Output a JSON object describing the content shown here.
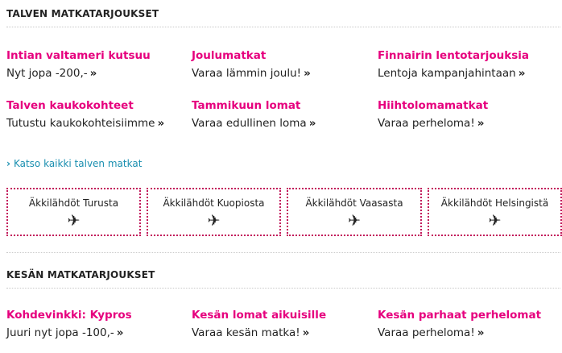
{
  "winter": {
    "title": "TALVEN MATKATARJOUKSET",
    "offers": [
      {
        "title": "Intian valtameri kutsuu",
        "subtitle": "Nyt jopa -200,-"
      },
      {
        "title": "Joulumatkat",
        "subtitle": "Varaa lämmin joulu!"
      },
      {
        "title": "Finnairin lentotarjouksia",
        "subtitle": "Lentoja kampanjahintaan"
      },
      {
        "title": "Talven kaukokohteet",
        "subtitle": "Tutustu kaukokohteisiimme"
      },
      {
        "title": "Tammikuun lomat",
        "subtitle": "Varaa edullinen loma"
      },
      {
        "title": "Hiihtolomamatkat",
        "subtitle": "Varaa perheloma!"
      }
    ],
    "all_link_chevron": "›",
    "all_link": "Katso kaikki talven matkat"
  },
  "departures": [
    {
      "label": "Äkkilähdöt Turusta",
      "icon": "airplane-icon"
    },
    {
      "label": "Äkkilähdöt Kuopiosta",
      "icon": "airplane-icon"
    },
    {
      "label": "Äkkilähdöt Vaasasta",
      "icon": "airplane-icon"
    },
    {
      "label": "Äkkilähdöt Helsingistä",
      "icon": "airplane-icon"
    }
  ],
  "plane_glyph": "✈",
  "raquo": "»",
  "summer": {
    "title": "KESÄN MATKATARJOUKSET",
    "offers": [
      {
        "title": "Kohdevinkki: Kypros",
        "subtitle": "Juuri nyt jopa -100,-"
      },
      {
        "title": "Kesän lomat aikuisille",
        "subtitle": "Varaa kesän matka!"
      },
      {
        "title": "Kesän parhaat perhelomat",
        "subtitle": "Varaa perheloma!"
      }
    ]
  },
  "colors": {
    "accent": "#e6007e",
    "link": "#1a8fb0",
    "dotted_border": "#c2185b"
  }
}
